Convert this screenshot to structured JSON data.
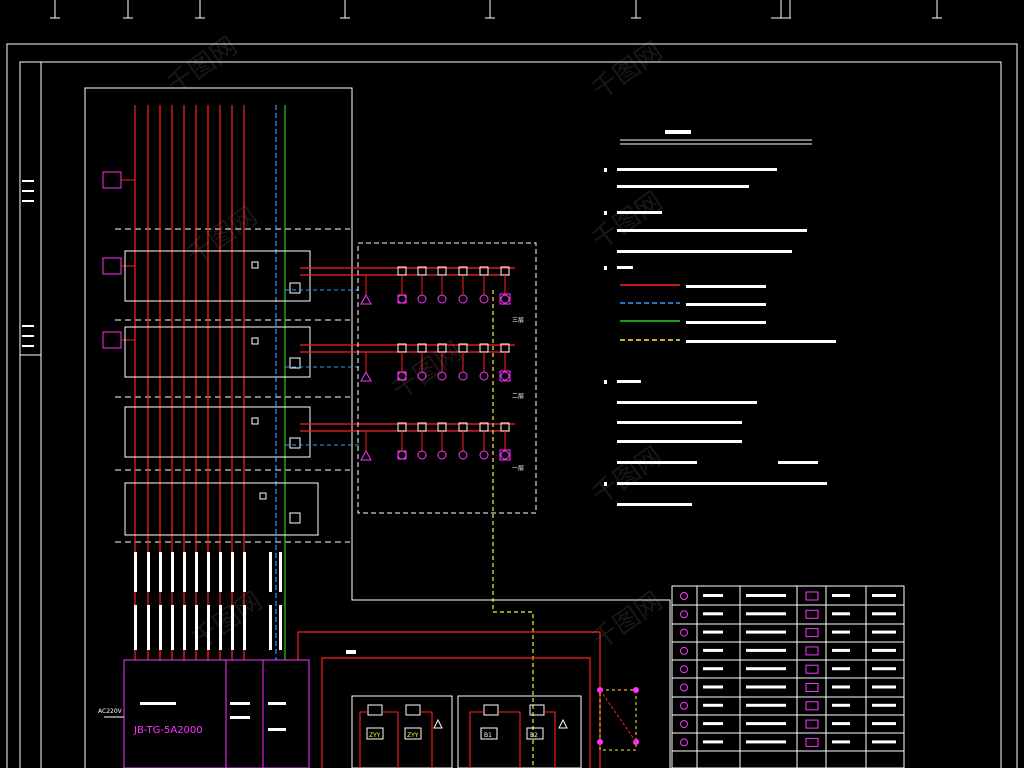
{
  "diagram": {
    "main_panel": {
      "controller_model": "JB-TG-5A2000",
      "power_label": "AC220V"
    },
    "floor_labels": [
      "三层",
      "二层",
      "一层"
    ],
    "small_labels": {
      "b1": "B1",
      "b2": "B2",
      "zyy": "ZYY"
    },
    "colors": {
      "background": "#000000",
      "frame": "#ffffff",
      "red_bus": "#ff2020",
      "blue_dashed": "#3399ff",
      "green": "#22cc22",
      "yellow_dashed": "#ffee33",
      "magenta": "#ff33ff"
    },
    "watermark": "千图网"
  }
}
